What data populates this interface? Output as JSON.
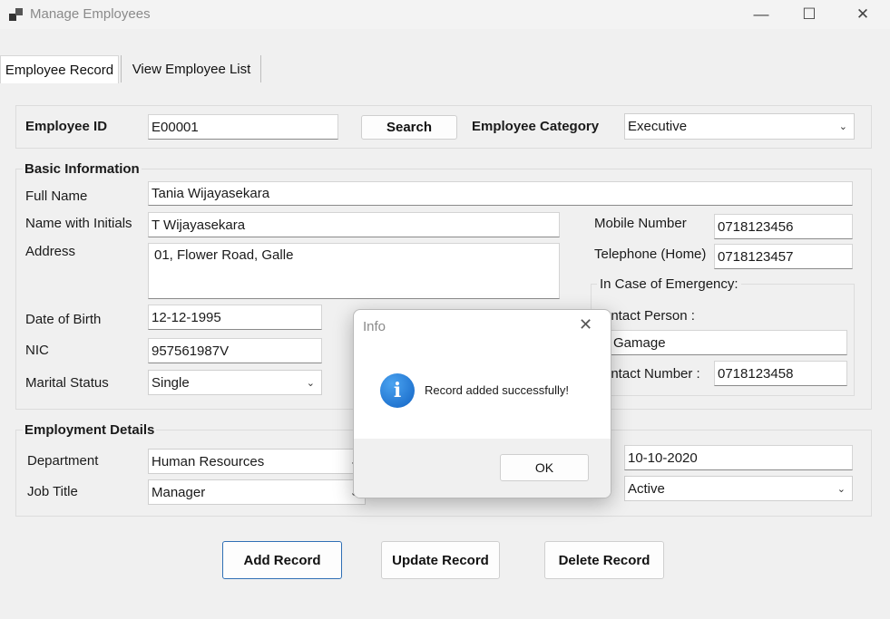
{
  "window": {
    "title": "Manage Employees",
    "minimize_glyph": "—",
    "maximize_glyph": "☐",
    "close_glyph": "✕"
  },
  "tabs": [
    {
      "label": "Employee Record",
      "active": true
    },
    {
      "label": "View Employee List",
      "active": false
    }
  ],
  "search_bar": {
    "employee_id_label": "Employee ID",
    "employee_id_value": "E00001",
    "search_button": "Search",
    "category_label": "Employee Category",
    "category_value": "Executive"
  },
  "basic_info": {
    "title": "Basic Information",
    "full_name_label": "Full Name",
    "full_name_value": "Tania Wijayasekara",
    "initials_label": "Name with Initials",
    "initials_value": "T Wijayasekara",
    "address_label": "Address",
    "address_value": "01, Flower Road, Galle",
    "dob_label": "Date of Birth",
    "dob_value": "12-12-1995",
    "nic_label": "NIC",
    "nic_value": "957561987V",
    "marital_label": "Marital Status",
    "marital_value": "Single",
    "mobile_label": "Mobile Number",
    "mobile_value": "0718123456",
    "telephone_label": "Telephone (Home)",
    "telephone_value": "0718123457",
    "emergency": {
      "title": "In Case of Emergency:",
      "contact_person_label": "ontact Person :",
      "contact_person_value": "Gamage",
      "contact_number_label": "ontact Number :",
      "contact_number_value": "0718123458"
    }
  },
  "employment": {
    "title": "Employment Details",
    "department_label": "Department",
    "department_value": "Human Resources",
    "job_title_label": "Job Title",
    "job_title_value": "Manager",
    "date_value": "10-10-2020",
    "status_value": "Active"
  },
  "actions": {
    "add": "Add Record",
    "update": "Update Record",
    "delete": "Delete Record"
  },
  "dialog": {
    "title": "Info",
    "message": "Record added successfully!",
    "ok": "OK",
    "icon_glyph": "i",
    "close_glyph": "✕"
  },
  "colors": {
    "window_bg": "#f0f0f0",
    "primary_border": "#2f6fb5",
    "info_icon": "#1f7fdc"
  }
}
